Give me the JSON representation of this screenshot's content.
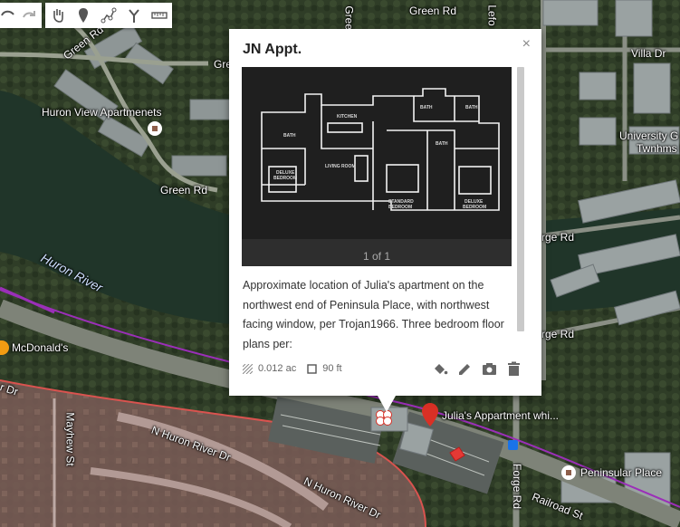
{
  "popup": {
    "title": "JN Appt.",
    "close_symbol": "×",
    "image_counter": "1 of 1",
    "description": "Approximate location of Julia's apartment on the northwest end of Peninsula Place, with northwest facing window, per Trojan1966.   Three bedroom floor plans per:",
    "area": "0.012 ac",
    "perimeter": "90 ft",
    "floorplan_labels": {
      "kitchen": "KITCHEN",
      "bath1": "BATH",
      "bath2": "BATH",
      "bath3": "BATH",
      "bath4": "BATH",
      "living": "LIVING ROOM",
      "deluxe1": "DELUXE",
      "deluxe1b": "BEDROOM",
      "standard": "STANDARD",
      "standardb": "BEDROOM",
      "deluxe2": "DELUXE",
      "deluxe2b": "BEDROOM"
    }
  },
  "map_labels": {
    "green_rd_top": "Green Rd",
    "green_rd_left": "Green Rd",
    "green_rd_mid": "Gre",
    "green_rd_bottom": "Green Rd",
    "huron_view": "Huron View Apartmenets",
    "huron_river": "Huron River",
    "mcdonalds": "McDonald's",
    "river_dr_left": "r Dr",
    "n_huron_river_dr_1": "N Huron River Dr",
    "n_huron_river_dr_2": "N Huron River Dr",
    "mayhew": "Mayhew St",
    "leforge_top": "Lefo",
    "villa_dr": "Villa Dr",
    "university": "University G",
    "twnhms": "Twnhms N",
    "forge_rd_right": "rge Rd",
    "forge_rd_right2": "rge Rd",
    "forge_rd_bottom": "Forge Rd",
    "julia": "Julia's Appartment whi...",
    "peninsular": "Peninsular Place",
    "railroad": "Railroad St",
    "green_vert": "Green"
  },
  "colors": {
    "accent_red": "#d93025",
    "boundary_purple": "#9b2fb8"
  }
}
